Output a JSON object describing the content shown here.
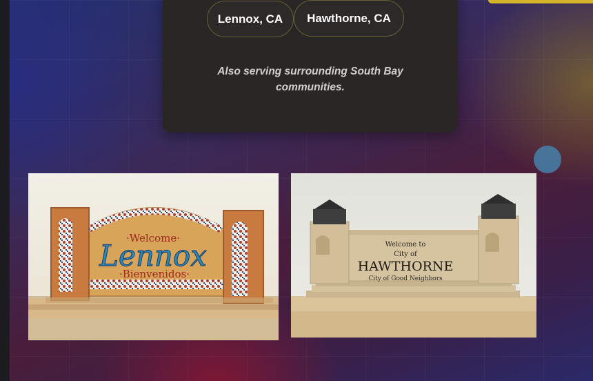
{
  "service_areas": {
    "chips": [
      "Lennox, CA",
      "Hawthorne, CA"
    ],
    "note": "Also serving surrounding South Bay communities."
  },
  "gallery": {
    "lennox_sign": {
      "welcome": "·Welcome·",
      "name": "Lennox",
      "bienvenidos": "·Bienvenidos·"
    },
    "hawthorne_sign": {
      "welcome": "Welcome to",
      "city_of": "City of",
      "name": "HAWTHORNE",
      "motto": "City of Good Neighbors"
    }
  },
  "colors": {
    "accent_gold": "#d4b52a",
    "card_bg": "#2a2625",
    "chip_border": "#6a6036"
  }
}
